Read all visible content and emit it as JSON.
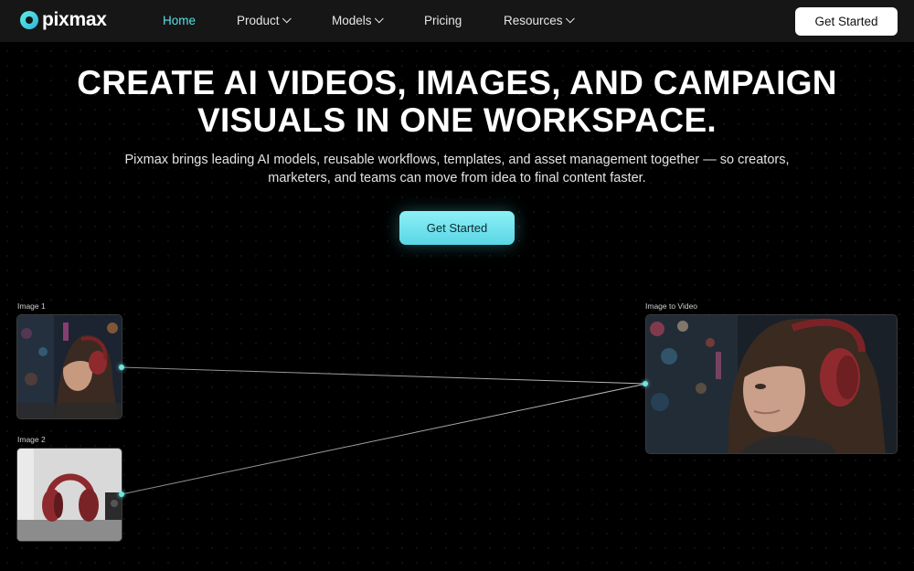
{
  "brand": {
    "name": "pixmax"
  },
  "nav": {
    "items": [
      {
        "label": "Home",
        "active": true,
        "dropdown": false
      },
      {
        "label": "Product",
        "active": false,
        "dropdown": true
      },
      {
        "label": "Models",
        "active": false,
        "dropdown": true
      },
      {
        "label": "Pricing",
        "active": false,
        "dropdown": false
      },
      {
        "label": "Resources",
        "active": false,
        "dropdown": true
      }
    ],
    "cta_label": "Get Started"
  },
  "hero": {
    "title_line1": "CREATE AI VIDEOS, IMAGES, AND CAMPAIGN",
    "title_line2": "VISUALS IN ONE WORKSPACE.",
    "subtitle_line1": "Pixmax brings leading AI models, reusable workflows, templates, and asset management together — so creators,",
    "subtitle_line2": "marketers, and teams can move from idea to final content faster.",
    "cta_label": "Get Started"
  },
  "workflow": {
    "node1_label": "Image 1",
    "node2_label": "Image 2",
    "output_label": "Image to Video"
  },
  "colors": {
    "accent": "#54e0e8",
    "background": "#000000",
    "navbar": "#161616",
    "cta_gradient_top": "#8df0f5",
    "headphone_red": "#8e2a2e"
  }
}
